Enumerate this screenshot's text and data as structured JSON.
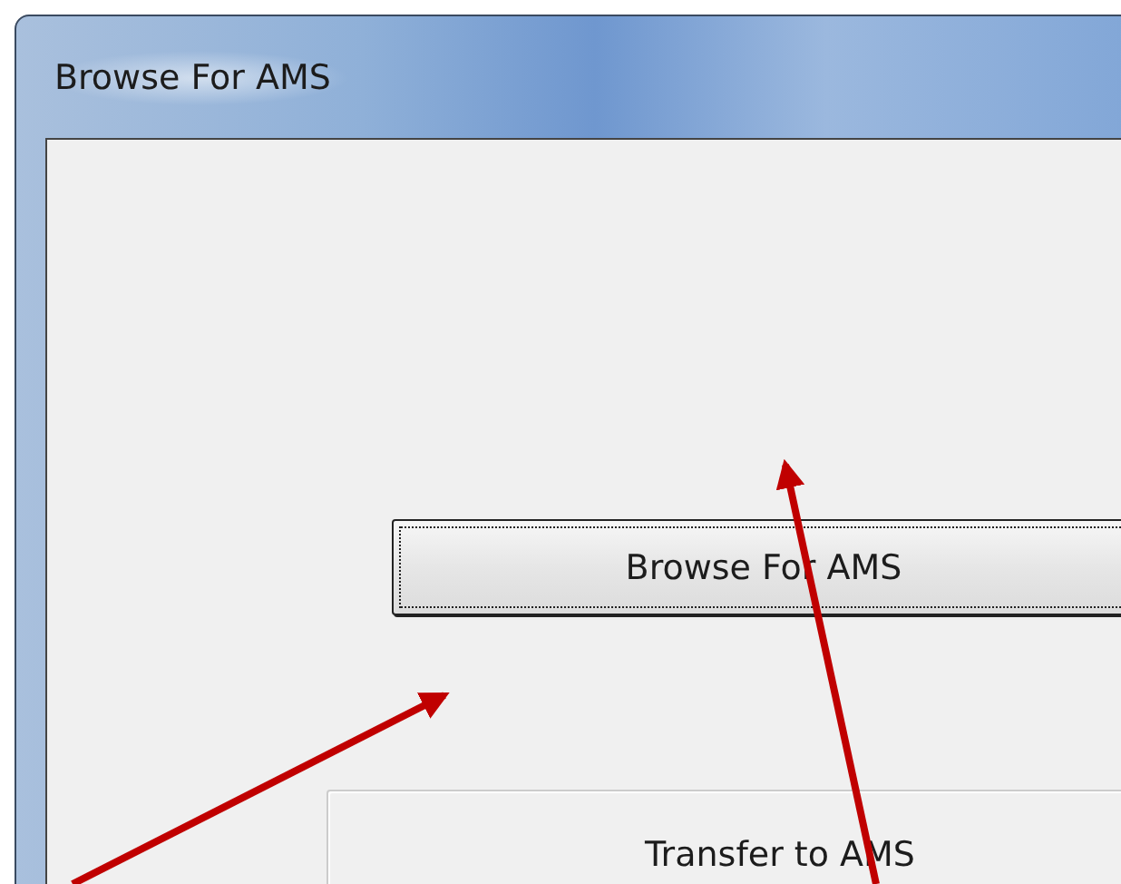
{
  "window": {
    "title": "Browse For AMS"
  },
  "buttons": [
    {
      "label": "Browse For AMS",
      "focused": true
    },
    {
      "label": "Transfer to AMS",
      "focused": false
    }
  ]
}
